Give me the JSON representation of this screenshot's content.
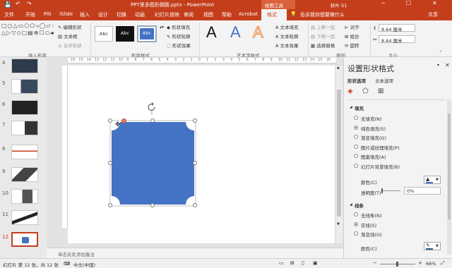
{
  "title_bar": {
    "doc_title": "PPT里多图形倒圆.pptx - PowerPoint",
    "contextual_tab": "绘图工具",
    "user": "秋叶 S1"
  },
  "tabs": [
    "文件",
    "开始",
    "Piti",
    "iSlide",
    "插入",
    "设计",
    "切换",
    "动画",
    "幻灯片放映",
    "审阅",
    "视图",
    "帮助",
    "Acrobat",
    "格式"
  ],
  "tell_me": "告诉我你想要做什么",
  "share": "共享",
  "ribbon": {
    "insert_shape": {
      "edit_shape": "编辑形状",
      "textbox": "文本框",
      "merge": "合并形状",
      "label": "插入形状"
    },
    "shape_styles": {
      "style1": "Abc",
      "style2": "Abc",
      "style3": "Abc",
      "fill": "形状填充",
      "outline": "形状轮廓",
      "effect": "形状效果",
      "label": "形状样式"
    },
    "art_styles": {
      "a1": "A",
      "a2": "A",
      "a3": "A",
      "text_fill": "文本填充",
      "text_outline": "文本轮廓",
      "text_effect": "文本效果",
      "label": "艺术字样式"
    },
    "arrange": {
      "bring_forward": "上移一层",
      "send_backward": "下移一层",
      "selection_pane": "选择窗格",
      "align": "对齐",
      "group": "组合",
      "rotate": "旋转",
      "label": "排列"
    },
    "size": {
      "height": "8.64 厘米",
      "width": "8.64 厘米",
      "label": "大小"
    }
  },
  "ruler_labels": [
    "16",
    "15",
    "14",
    "13",
    "12",
    "11",
    "10",
    "9",
    "8",
    "7",
    "6",
    "5",
    "4",
    "3",
    "2",
    "1",
    "0",
    "1",
    "2",
    "3",
    "4",
    "5",
    "6",
    "7",
    "8",
    "9",
    "10",
    "11",
    "12",
    "13",
    "14",
    "15",
    "16"
  ],
  "slides": [
    {
      "n": "4"
    },
    {
      "n": "5"
    },
    {
      "n": "6"
    },
    {
      "n": "7"
    },
    {
      "n": "8"
    },
    {
      "n": "9"
    },
    {
      "n": "10"
    },
    {
      "n": "11"
    },
    {
      "n": "12"
    }
  ],
  "notes_placeholder": "单击此处添加备注",
  "format_pane": {
    "title": "设置形状格式",
    "tab_shape": "形状选项",
    "tab_text": "文本选项",
    "fill_header": "填充",
    "fill_options": [
      "无填充(N)",
      "纯色填充(S)",
      "渐变填充(G)",
      "图片或纹理填充(P)",
      "图案填充(A)",
      "幻灯片背景填充(B)"
    ],
    "fill_selected": 1,
    "color_label": "颜色(C)",
    "transparency_label": "透明度(T)",
    "transparency_value": "0%",
    "line_header": "线条",
    "line_options": [
      "无线条(N)",
      "实线(S)",
      "渐变线(G)"
    ],
    "line_selected": 1,
    "line_color_label": "颜色(C)"
  },
  "status": {
    "slide_info": "幻灯片 第 12 张，共 12 张",
    "language": "中文(中国)",
    "zoom": "66%"
  },
  "colors": {
    "accent": "#c43e1c",
    "shape_fill": "#4472c4"
  }
}
